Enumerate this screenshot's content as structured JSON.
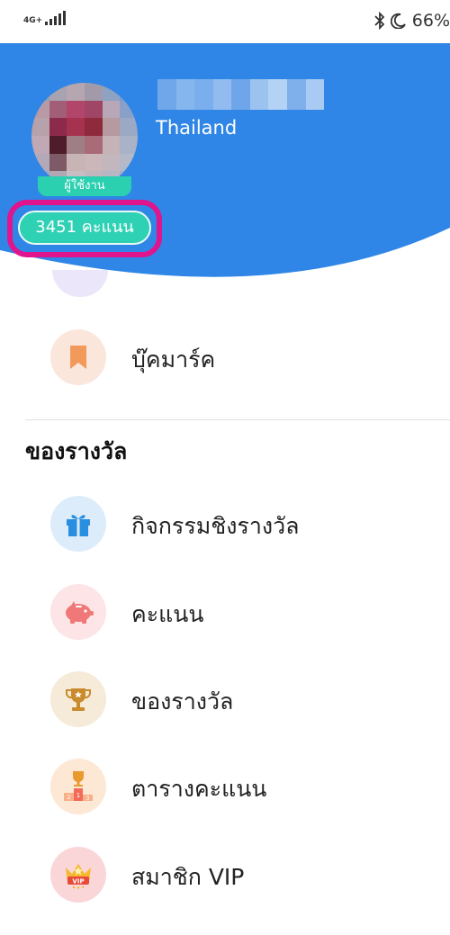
{
  "status_bar": {
    "network": "4G+",
    "battery": "66%"
  },
  "profile": {
    "country": "Thailand",
    "avatar_badge": "ผู้ใช้งาน",
    "points_label": "3451 คะแนน"
  },
  "bookmark_item": {
    "label": "บุ๊คมาร์ค",
    "icon": "bookmark-icon",
    "color": "#f29a5c"
  },
  "rewards_section": {
    "title": "ของรางวัล",
    "items": [
      {
        "label": "กิจกรรมชิงรางวัล",
        "icon": "gift-icon"
      },
      {
        "label": "คะแนน",
        "icon": "piggy-bank-icon"
      },
      {
        "label": "ของรางวัล",
        "icon": "trophy-icon"
      },
      {
        "label": "ตารางคะแนน",
        "icon": "leaderboard-podium-icon"
      },
      {
        "label": "สมาชิก VIP",
        "icon": "vip-crown-icon"
      }
    ]
  },
  "colors": {
    "header_blue": "#2f86e6",
    "points_pill": "#2ed1b4",
    "highlight": "#e0148c"
  }
}
